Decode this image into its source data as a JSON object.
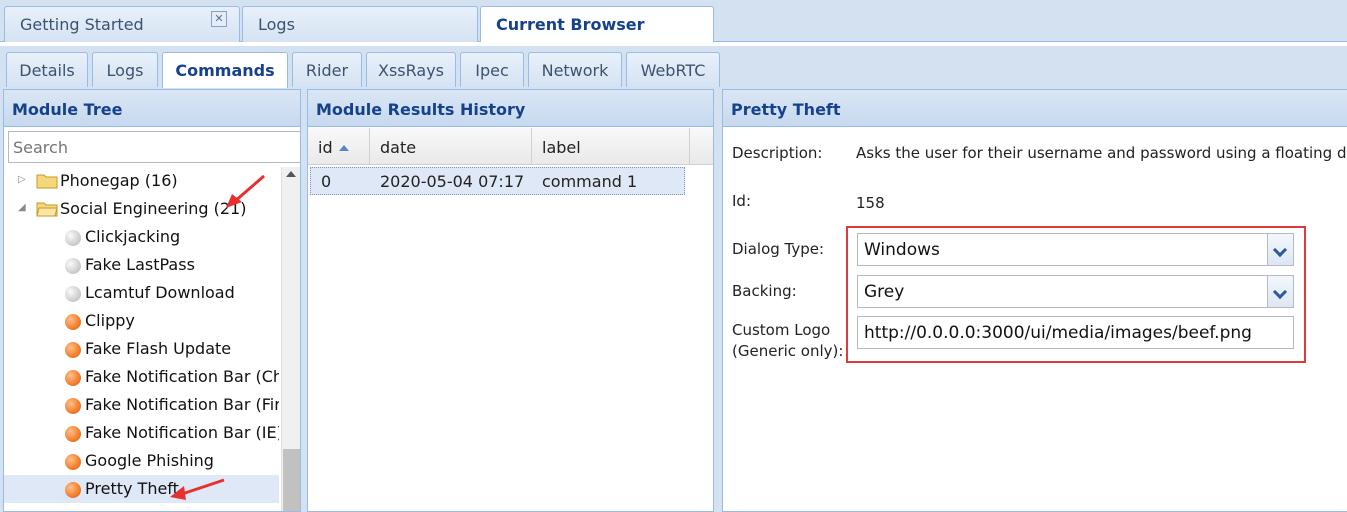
{
  "top_tabs": [
    {
      "label": "Getting Started",
      "closable": true
    },
    {
      "label": "Logs"
    },
    {
      "label": "Current Browser",
      "active": true
    }
  ],
  "sub_tabs": [
    {
      "label": "Details"
    },
    {
      "label": "Logs"
    },
    {
      "label": "Commands",
      "active": true
    },
    {
      "label": "Rider"
    },
    {
      "label": "XssRays"
    },
    {
      "label": "Ipec"
    },
    {
      "label": "Network"
    },
    {
      "label": "WebRTC"
    }
  ],
  "module_tree": {
    "title": "Module Tree",
    "search_placeholder": "Search",
    "items": [
      {
        "label": "Phonegap (16)",
        "type": "folder",
        "expanded": false
      },
      {
        "label": "Social Engineering (21)",
        "type": "folder",
        "expanded": true
      },
      {
        "label": "Clickjacking",
        "status": "grey"
      },
      {
        "label": "Fake LastPass",
        "status": "grey"
      },
      {
        "label": "Lcamtuf Download",
        "status": "grey"
      },
      {
        "label": "Clippy",
        "status": "orange"
      },
      {
        "label": "Fake Flash Update",
        "status": "orange"
      },
      {
        "label": "Fake Notification Bar (Ch",
        "status": "orange"
      },
      {
        "label": "Fake Notification Bar (Fir",
        "status": "orange"
      },
      {
        "label": "Fake Notification Bar (IE)",
        "status": "orange"
      },
      {
        "label": "Google Phishing",
        "status": "orange"
      },
      {
        "label": "Pretty Theft",
        "status": "orange",
        "selected": true
      }
    ]
  },
  "results_history": {
    "title": "Module Results History",
    "columns": [
      "id",
      "date",
      "label"
    ],
    "rows": [
      {
        "id": "0",
        "date": "2020-05-04 07:17",
        "label": "command 1"
      }
    ]
  },
  "module_detail": {
    "title": "Pretty Theft",
    "description_label": "Description:",
    "description": "Asks the user for their username and password using a floating d",
    "id_label": "Id:",
    "id": "158",
    "dialog_type_label": "Dialog Type:",
    "dialog_type": "Windows",
    "backing_label": "Backing:",
    "backing": "Grey",
    "custom_logo_label": "Custom Logo",
    "custom_logo_sub": "(Generic only):",
    "custom_logo": "http://0.0.0.0:3000/ui/media/images/beef.png"
  },
  "colors": {
    "accent_text": "#15428b",
    "panel_border": "#99bbe8",
    "highlight_box": "#e03a3a",
    "status_orange": "#f27d2c",
    "status_grey": "#cfcfcf"
  }
}
